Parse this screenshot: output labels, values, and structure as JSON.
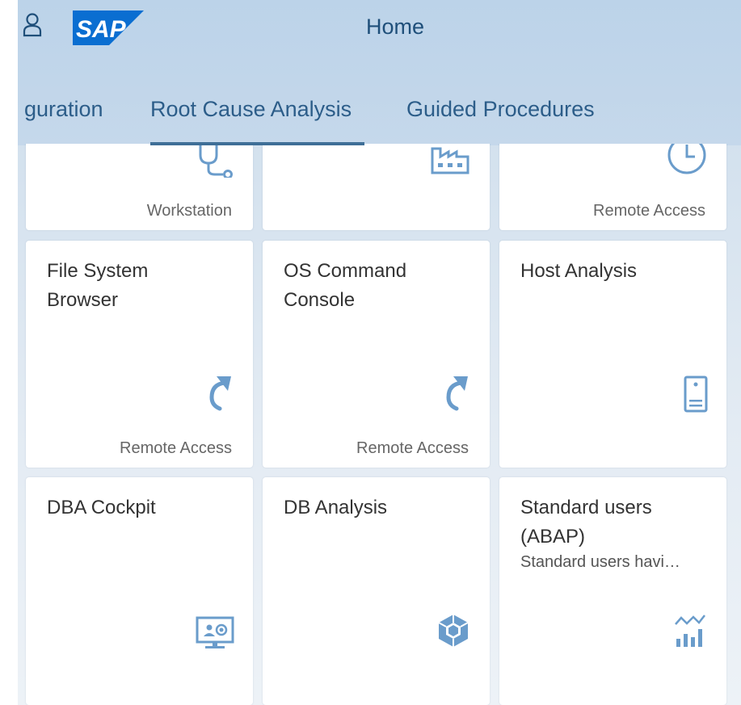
{
  "header": {
    "title": "Home",
    "logo_text": "SAP",
    "brand_color": "#0a6ed1"
  },
  "tabs": [
    {
      "label": "guration",
      "selected": false
    },
    {
      "label": "Root Cause Analysis",
      "selected": true
    },
    {
      "label": "Guided Procedures",
      "selected": false
    }
  ],
  "tiles": [
    {
      "title": "",
      "subtitle": "",
      "footer": "Workstation",
      "icon": "stethoscope-icon"
    },
    {
      "title": "",
      "subtitle": "",
      "footer": "",
      "icon": "factory-icon"
    },
    {
      "title": "",
      "subtitle": "",
      "footer": "Remote Access",
      "icon": "clock-icon"
    },
    {
      "title": "File System Browser",
      "subtitle": "",
      "footer": "Remote Access",
      "icon": "refresh-arrow-icon"
    },
    {
      "title": "OS Command Console",
      "subtitle": "",
      "footer": "Remote Access",
      "icon": "refresh-arrow-icon"
    },
    {
      "title": "Host Analysis",
      "subtitle": "",
      "footer": "",
      "icon": "host-device-icon"
    },
    {
      "title": "DBA Cockpit",
      "subtitle": "",
      "footer": "",
      "icon": "monitor-users-icon"
    },
    {
      "title": "DB Analysis",
      "subtitle": "",
      "footer": "",
      "icon": "cubes-icon"
    },
    {
      "title": "Standard users (ABAP)",
      "subtitle": "Standard users havi…",
      "footer": "",
      "icon": "chart-trend-icon"
    }
  ],
  "colors": {
    "accent": "#2c5d89",
    "icon": "#6a9ccb",
    "tile_background": "#ffffff"
  }
}
